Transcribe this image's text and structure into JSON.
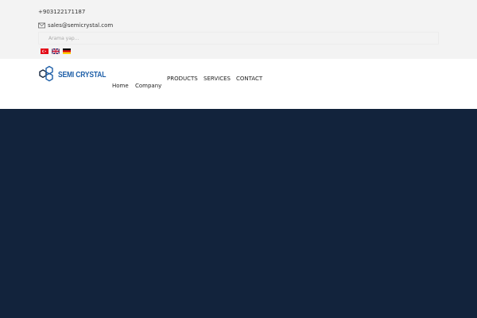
{
  "topbar": {
    "phone": "+903122171187",
    "email": "sales@semicrystal.com",
    "email_icon": "envelope-icon",
    "search_placeholder": "Arama yap...",
    "languages": [
      {
        "code": "tr",
        "icon": "turkey-flag-icon"
      },
      {
        "code": "en",
        "icon": "uk-flag-icon"
      },
      {
        "code": "de",
        "icon": "germany-flag-icon"
      }
    ]
  },
  "header": {
    "logo_text": "SEMI CRYSTAL",
    "nav": {
      "home": "Home",
      "company": "Company",
      "products": "PRODUCTS",
      "services": "SERVICES",
      "contact": "CONTACT"
    }
  },
  "colors": {
    "topbar_bg": "#f3f3f3",
    "brand_blue": "#1e5fa8",
    "hero_bg": "#12233c"
  }
}
